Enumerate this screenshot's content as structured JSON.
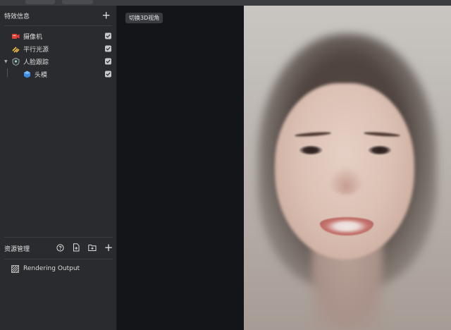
{
  "effects_panel": {
    "title": "特效信息",
    "add_icon": "plus-icon",
    "items": [
      {
        "label": "摄像机",
        "icon": "camera-icon",
        "checked": true
      },
      {
        "label": "平行光源",
        "icon": "directional-light-icon",
        "checked": true
      },
      {
        "label": "人脸跟踪",
        "icon": "face-tracking-icon",
        "checked": true,
        "expanded": true
      },
      {
        "label": "头模",
        "icon": "head-model-icon",
        "checked": true
      }
    ]
  },
  "resource_panel": {
    "title": "资源管理",
    "toolbar_icons": [
      "help-icon",
      "add-file-icon",
      "add-folder-icon",
      "plus-icon"
    ],
    "items": [
      {
        "label": "Rendering Output",
        "icon": "rendering-output-icon"
      }
    ]
  },
  "viewport": {
    "switch_button": "切换3D视角"
  },
  "colors": {
    "panel_bg": "#2a2b2f",
    "viewport_bg": "#141518",
    "camera_icon": "#e0423a",
    "light_icon": "#f0c040",
    "head_icon": "#3f8ee8"
  }
}
